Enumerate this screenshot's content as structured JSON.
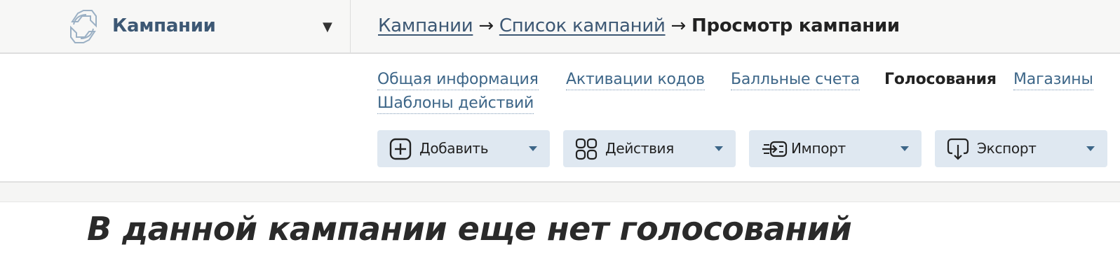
{
  "header": {
    "section_title": "Кампании",
    "section_caret": "▼",
    "breadcrumb": {
      "items": [
        "Кампании",
        "Список кампаний"
      ],
      "separator": "→",
      "current": "Просмотр кампании"
    }
  },
  "tabs": [
    {
      "label": "Общая информация",
      "active": false
    },
    {
      "label": "Активации кодов",
      "active": false
    },
    {
      "label": "Балльные счета",
      "active": false
    },
    {
      "label": "Голосования",
      "active": true
    },
    {
      "label": "Магазины",
      "active": false
    },
    {
      "label": "Шаблоны действий",
      "active": false
    }
  ],
  "actions": [
    {
      "label": "Добавить",
      "icon": "plus-square-icon"
    },
    {
      "label": "Действия",
      "icon": "grid-icon"
    },
    {
      "label": "Импорт",
      "icon": "import-icon"
    },
    {
      "label": "Экспорт",
      "icon": "export-icon"
    }
  ],
  "main": {
    "empty_message": "В данной кампании еще нет голосований"
  },
  "colors": {
    "link": "#3d6688",
    "brand_title": "#3d5874",
    "button_bg": "#dfe8f1",
    "topbar_bg": "#f7f7f6"
  }
}
